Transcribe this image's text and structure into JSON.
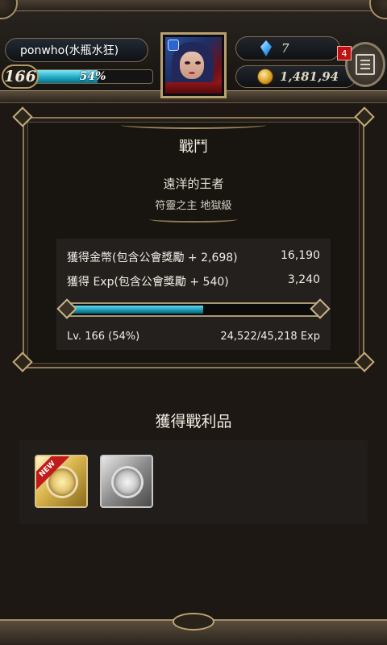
{
  "hud": {
    "player_name": "ponwho(水瓶水狂)",
    "level": "166",
    "exp_percent_text": "54%",
    "exp_fraction": 0.54,
    "gems": "7",
    "gold": "1,481,94",
    "notification_count": "4"
  },
  "battle": {
    "title": "戰鬥",
    "stage_name": "遠洋的王者",
    "stage_difficulty": "符靈之主 地獄級",
    "gold_label": "獲得金幣(包含公會獎勵 + 2,698)",
    "gold_value": "16,190",
    "exp_label": "獲得 Exp(包含公會獎勵 + 540)",
    "exp_value": "3,240",
    "level_text": "Lv. 166 (54%)",
    "exp_progress_text": "24,522/45,218 Exp",
    "exp_fraction": 0.54
  },
  "loot": {
    "title": "獲得戰利品",
    "items": [
      {
        "name": "gold-plate",
        "new_label": "NEW"
      },
      {
        "name": "silver-plate"
      }
    ]
  }
}
